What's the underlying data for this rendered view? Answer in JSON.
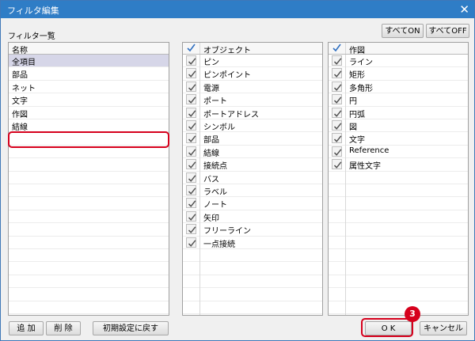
{
  "window": {
    "title": "フィルタ編集",
    "close_glyph": "✕"
  },
  "buttons": {
    "all_on": "すべてON",
    "all_off": "すべてOFF",
    "add": "追 加",
    "delete": "削 除",
    "reset": "初期設定に戻す",
    "ok": "O K",
    "cancel": "キャンセル"
  },
  "filter_list": {
    "section_label": "フィルタ一覧",
    "header": "名称",
    "items": [
      "全項目",
      "部品",
      "ネット",
      "文字",
      "作図",
      "結線",
      ""
    ],
    "selected_index": 0,
    "editing_index": 6
  },
  "object_list": {
    "header": "オブジェクト",
    "header_checked": true,
    "items": [
      {
        "label": "ピン",
        "checked": true
      },
      {
        "label": "ピンポイント",
        "checked": true
      },
      {
        "label": "電源",
        "checked": true
      },
      {
        "label": "ポート",
        "checked": true
      },
      {
        "label": "ポートアドレス",
        "checked": true
      },
      {
        "label": "シンボル",
        "checked": true
      },
      {
        "label": "部品",
        "checked": true
      },
      {
        "label": "結線",
        "checked": true
      },
      {
        "label": "接続点",
        "checked": true
      },
      {
        "label": "バス",
        "checked": true
      },
      {
        "label": "ラベル",
        "checked": true
      },
      {
        "label": "ノート",
        "checked": true
      },
      {
        "label": "矢印",
        "checked": true
      },
      {
        "label": "フリーライン",
        "checked": true
      },
      {
        "label": "一点接続",
        "checked": true
      }
    ]
  },
  "drawing_list": {
    "header": "作図",
    "header_checked": true,
    "items": [
      {
        "label": "ライン",
        "checked": true
      },
      {
        "label": "矩形",
        "checked": true
      },
      {
        "label": "多角形",
        "checked": true
      },
      {
        "label": "円",
        "checked": true
      },
      {
        "label": "円弧",
        "checked": true
      },
      {
        "label": "図",
        "checked": true
      },
      {
        "label": "文字",
        "checked": true
      },
      {
        "label": "Reference",
        "checked": true
      },
      {
        "label": "属性文字",
        "checked": true
      }
    ]
  },
  "annotation": {
    "step_number": "3"
  },
  "colors": {
    "titlebar": "#2f7dc6",
    "highlight": "#d6001c",
    "check": "#2f6fc0"
  }
}
